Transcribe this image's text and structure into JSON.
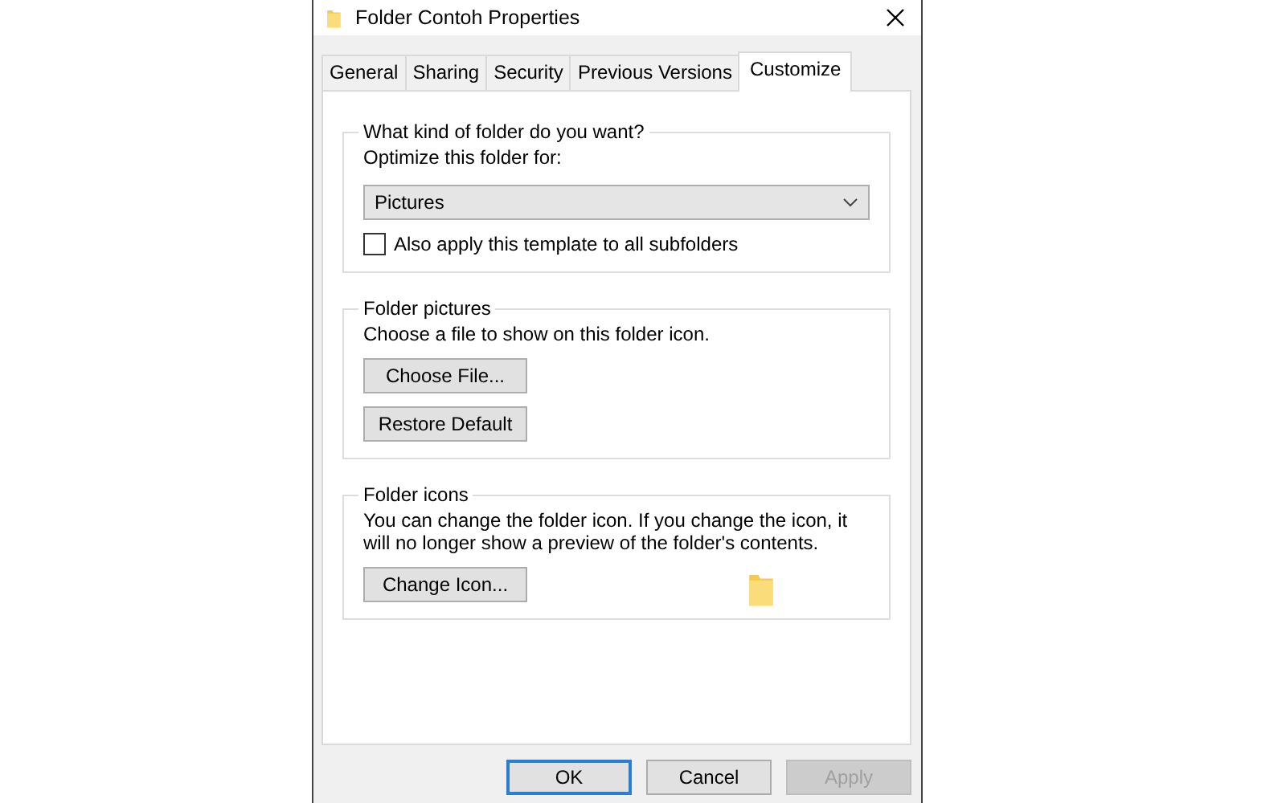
{
  "window": {
    "title": "Folder Contoh Properties"
  },
  "tabs": [
    {
      "label": "General",
      "selected": false
    },
    {
      "label": "Sharing",
      "selected": false
    },
    {
      "label": "Security",
      "selected": false
    },
    {
      "label": "Previous Versions",
      "selected": false
    },
    {
      "label": "Customize",
      "selected": true
    }
  ],
  "groups": [
    {
      "title": "What kind of folder do you want?",
      "kind": "template",
      "label": "Optimize this folder for:",
      "dropdown": {
        "value": "Pictures"
      },
      "checkbox": {
        "label": "Also apply this template to all subfolders",
        "checked": false
      }
    },
    {
      "title": "Folder pictures",
      "kind": "pictures",
      "text": "Choose a file to show on this folder icon.",
      "buttons": [
        "Choose File...",
        "Restore Default"
      ]
    },
    {
      "title": "Folder icons",
      "kind": "icons",
      "text": "You can change the folder icon. If you change the icon, it will no longer show a preview of the folder's contents.",
      "buttons": [
        "Change Icon..."
      ]
    }
  ],
  "buttons": [
    {
      "label": "OK",
      "default": true,
      "disabled": false
    },
    {
      "label": "Cancel",
      "default": false,
      "disabled": false
    },
    {
      "label": "Apply",
      "default": false,
      "disabled": true
    }
  ]
}
